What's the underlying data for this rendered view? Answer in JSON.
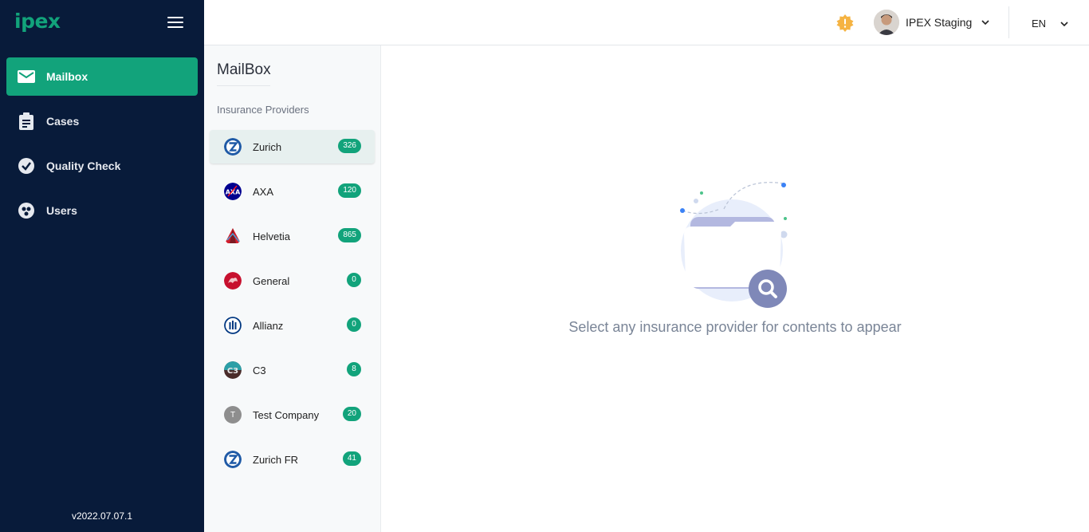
{
  "app": {
    "logo": "ipex",
    "version": "v2022.07.07.1"
  },
  "nav": {
    "items": [
      {
        "label": "Mailbox",
        "icon": "mail-icon",
        "active": true
      },
      {
        "label": "Cases",
        "icon": "clipboard-icon",
        "active": false
      },
      {
        "label": "Quality Check",
        "icon": "check-circle-icon",
        "active": false
      },
      {
        "label": "Users",
        "icon": "users-icon",
        "active": false
      }
    ]
  },
  "topbar": {
    "user_name": "IPEX Staging",
    "language": "EN"
  },
  "mailbox": {
    "title": "MailBox",
    "subtitle": "Insurance Providers",
    "providers": [
      {
        "name": "Zurich",
        "count": "326",
        "active": true
      },
      {
        "name": "AXA",
        "count": "120",
        "active": false
      },
      {
        "name": "Helvetia",
        "count": "865",
        "active": false
      },
      {
        "name": "General",
        "count": "0",
        "active": false
      },
      {
        "name": "Allianz",
        "count": "0",
        "active": false
      },
      {
        "name": "C3",
        "count": "8",
        "active": false
      },
      {
        "name": "Test Company",
        "count": "20",
        "active": false,
        "logo_letter": "T"
      },
      {
        "name": "Zurich FR",
        "count": "41",
        "active": false
      }
    ]
  },
  "main": {
    "empty_text": "Select any insurance provider for contents to appear"
  },
  "colors": {
    "sidebar": "#081b3a",
    "accent": "#12a37b",
    "warning": "#f5b342"
  }
}
